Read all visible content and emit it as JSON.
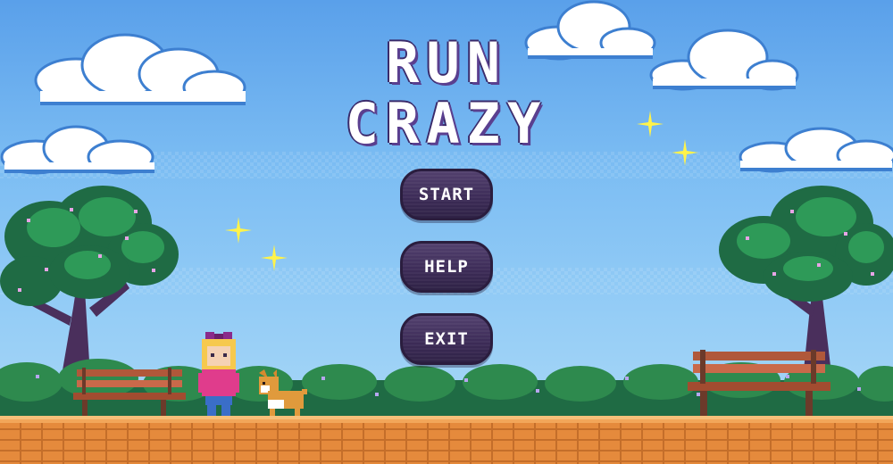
{
  "game": {
    "title_line1": "RUN",
    "title_line2": "CRAZY"
  },
  "menu": {
    "items": [
      {
        "label": "START"
      },
      {
        "label": "HELP"
      },
      {
        "label": "EXIT"
      }
    ]
  },
  "colors": {
    "sky_top": "#5aa0ea",
    "sky_bottom": "#a6d6f7",
    "button_fill": "#3d2c58",
    "title_outline": "#3a2a6a",
    "ground": "#e58a3c",
    "foliage": "#2e8a4e",
    "sparkle": "#fff34a"
  },
  "scene": {
    "icons": [
      "cloud-icon",
      "tree-icon",
      "park-bench-icon",
      "girl-character-icon",
      "corgi-dog-icon",
      "sparkle-icon",
      "hedge-bush-icon",
      "brick-path"
    ]
  }
}
